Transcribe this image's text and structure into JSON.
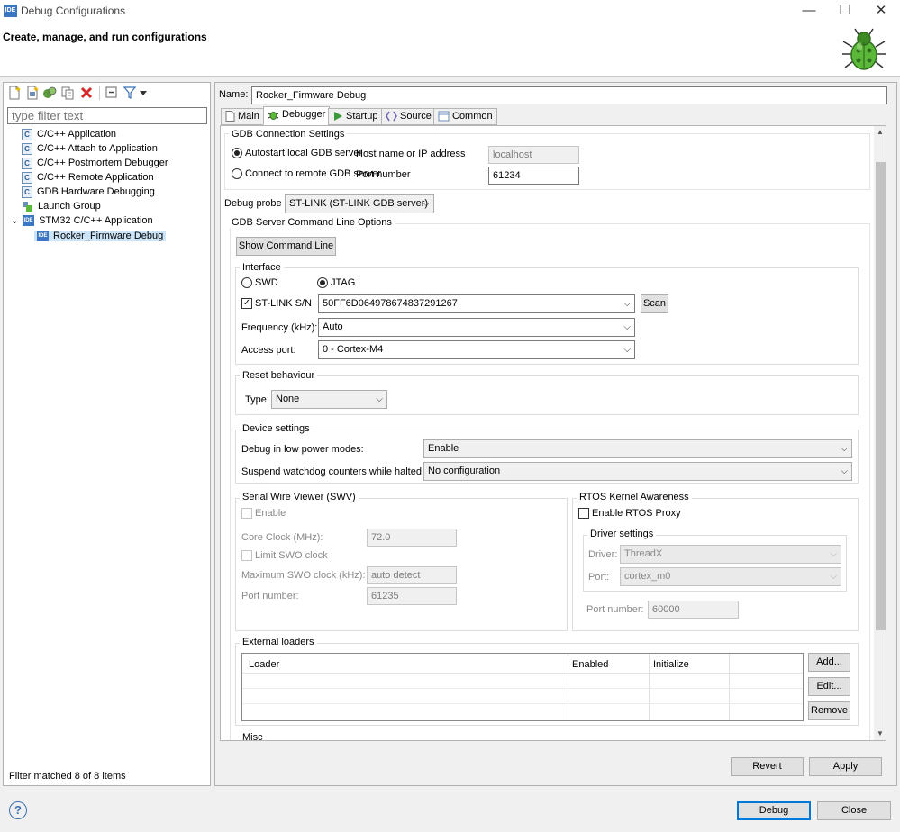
{
  "window": {
    "title": "Debug Configurations",
    "app_icon": "IDE",
    "minimize_icon": "—",
    "maximize_icon": "☐",
    "close_icon": "✕"
  },
  "header": {
    "title": "Create, manage, and run configurations",
    "icon": "debug-bug-icon"
  },
  "left": {
    "toolbar": [
      "new-config-icon",
      "new-prototype-icon",
      "export-icon",
      "duplicate-icon",
      "delete-icon",
      "collapse-all-icon",
      "filter-icon",
      "view-menu-icon"
    ],
    "filter_placeholder": "type filter text",
    "tree": [
      {
        "label": "C/C++ Application",
        "icon": "C"
      },
      {
        "label": "C/C++ Attach to Application",
        "icon": "C"
      },
      {
        "label": "C/C++ Postmortem Debugger",
        "icon": "C"
      },
      {
        "label": "C/C++ Remote Application",
        "icon": "C"
      },
      {
        "label": "GDB Hardware Debugging",
        "icon": "C"
      },
      {
        "label": "Launch Group",
        "icon": "launch"
      },
      {
        "label": "STM32 C/C++ Application",
        "icon": "IDE",
        "expand": "⌄"
      },
      {
        "label": "Rocker_Firmware Debug",
        "icon": "IDE"
      }
    ],
    "status": "Filter matched 8 of 8 items"
  },
  "config": {
    "name_label": "Name:",
    "name_value": "Rocker_Firmware Debug",
    "tabs": [
      "Main",
      "Debugger",
      "Startup",
      "Source",
      "Common"
    ]
  },
  "debugger": {
    "gdb_conn_title": "GDB Connection Settings",
    "autostart_label": "Autostart local GDB server",
    "remote_label": "Connect to remote GDB server",
    "host_label": "Host name or IP address",
    "host_value": "localhost",
    "port_label": "Port number",
    "port_value": "61234",
    "probe_label": "Debug probe",
    "probe_value": "ST-LINK (ST-LINK GDB server)",
    "server_opts_title": "GDB Server Command Line Options",
    "show_cmd_label": "Show Command Line",
    "interface_title": "Interface",
    "swd_label": "SWD",
    "jtag_label": "JTAG",
    "stlink_label": "ST-LINK S/N",
    "stlink_value": "50FF6D064978674837291267",
    "scan_label": "Scan",
    "freq_label": "Frequency (kHz):",
    "freq_value": "Auto",
    "access_label": "Access port:",
    "access_value": "0 - Cortex-M4",
    "reset_title": "Reset behaviour",
    "type_label": "Type:",
    "type_value": "None",
    "device_title": "Device settings",
    "lowpower_label": "Debug in low power modes:",
    "lowpower_value": "Enable",
    "watchdog_label": "Suspend watchdog counters while halted:",
    "watchdog_value": "No configuration",
    "swv_title": "Serial Wire Viewer (SWV)",
    "swv_enable": "Enable",
    "core_clock_label": "Core Clock (MHz):",
    "core_clock_value": "72.0",
    "limit_swo_label": "Limit SWO clock",
    "max_swo_label": "Maximum SWO clock (kHz):",
    "max_swo_value": "auto detect",
    "swv_port_label": "Port number:",
    "swv_port_value": "61235",
    "rtos_title": "RTOS Kernel Awareness",
    "rtos_proxy_label": "Enable RTOS Proxy",
    "driver_title": "Driver settings",
    "driver_label": "Driver:",
    "driver_value": "ThreadX",
    "rtos_port_label": "Port:",
    "rtos_port_value": "cortex_m0",
    "rtos_portnum_label": "Port number:",
    "rtos_portnum_value": "60000",
    "ext_loaders_title": "External loaders",
    "loader_cols": [
      "Loader",
      "Enabled",
      "Initialize"
    ],
    "add_label": "Add...",
    "edit_label": "Edit...",
    "remove_label": "Remove",
    "misc_title": "Misc"
  },
  "buttons": {
    "revert": "Revert",
    "apply": "Apply",
    "debug": "Debug",
    "close": "Close"
  },
  "help_icon": "?",
  "colors": {
    "accent": "#0078d7",
    "selection": "#cce4f7",
    "ide_blue": "#3b76c2"
  }
}
